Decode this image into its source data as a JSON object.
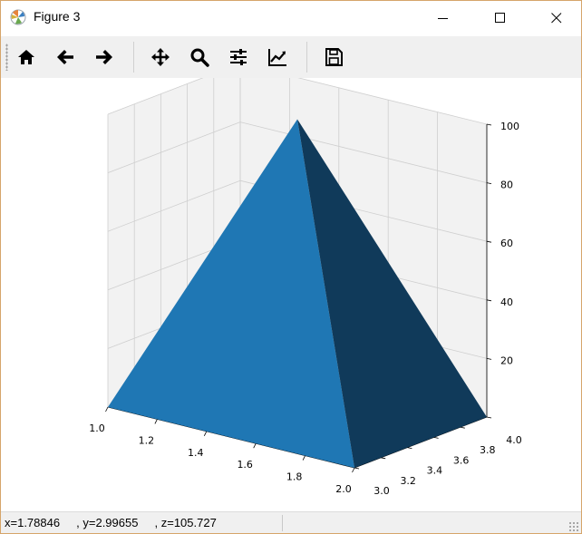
{
  "window": {
    "title": "Figure 3",
    "icon": "matplotlib-icon"
  },
  "toolbar": {
    "buttons": [
      {
        "name": "home",
        "icon": "home-icon"
      },
      {
        "name": "back",
        "icon": "arrow-left-icon"
      },
      {
        "name": "forward",
        "icon": "arrow-right-icon"
      },
      {
        "name": "pan",
        "icon": "move-icon"
      },
      {
        "name": "zoom",
        "icon": "magnifier-icon"
      },
      {
        "name": "configure-subplots",
        "icon": "sliders-icon"
      },
      {
        "name": "edit-axis",
        "icon": "line-chart-icon"
      },
      {
        "name": "save",
        "icon": "floppy-disk-icon"
      }
    ]
  },
  "status": {
    "coords": "x=1.78846     , y=2.99655     , z=105.727"
  },
  "colors": {
    "face_front": "#1f77b4",
    "face_shade": "#103a5a",
    "pane": "#f2f2f2",
    "grid": "#cfcfcf"
  },
  "chart_data": {
    "type": "surface-3d",
    "x_ticks": [
      "1.0",
      "1.2",
      "1.4",
      "1.6",
      "1.8",
      "2.0"
    ],
    "y_ticks": [
      "3.0",
      "3.2",
      "3.4",
      "3.6",
      "3.8",
      "4.0"
    ],
    "z_ticks": [
      "20",
      "40",
      "60",
      "80",
      "100"
    ],
    "xlim": [
      1.0,
      2.0
    ],
    "ylim": [
      3.0,
      4.0
    ],
    "zlim": [
      0,
      100
    ],
    "grid": true,
    "vertices": [
      {
        "x": 1.0,
        "y": 3.0,
        "z": 0
      },
      {
        "x": 2.0,
        "y": 3.0,
        "z": 0
      },
      {
        "x": 2.0,
        "y": 4.0,
        "z": 0
      },
      {
        "x": 1.5,
        "y": 3.5,
        "z": 100
      }
    ]
  }
}
